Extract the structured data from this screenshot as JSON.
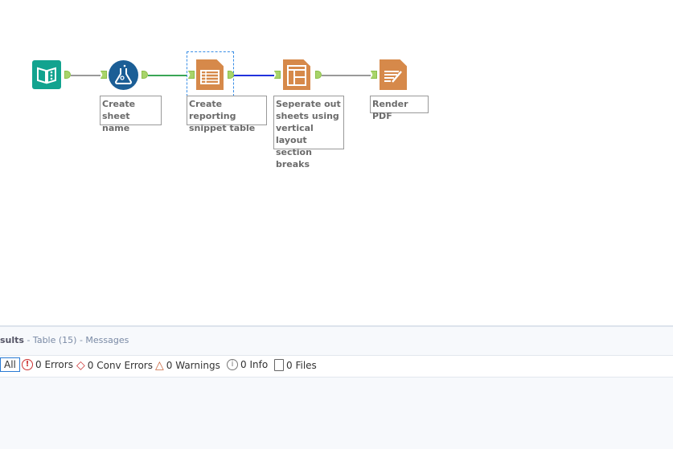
{
  "nodes": [
    {
      "name": "input",
      "label": ""
    },
    {
      "name": "formula",
      "label": "Create sheet name"
    },
    {
      "name": "table",
      "label": "Create reporting snippet table"
    },
    {
      "name": "layout",
      "label": "Seperate out sheets using vertical layout section breaks"
    },
    {
      "name": "render",
      "label": "Render PDF"
    }
  ],
  "colors": {
    "teal": "#12a38f",
    "blue": "#1b5e96",
    "orange": "#d6894a",
    "green_conn": "#3aa655",
    "blue_conn": "#2233dd",
    "gray_conn": "#999999"
  },
  "results": {
    "title": "sults",
    "subtitle": "- Table (15) - Messages",
    "filters": {
      "all": "All",
      "errors": "0 Errors",
      "conv_errors": "0 Conv Errors",
      "warnings": "0 Warnings",
      "info": "0 Info",
      "files": "0 Files"
    }
  }
}
